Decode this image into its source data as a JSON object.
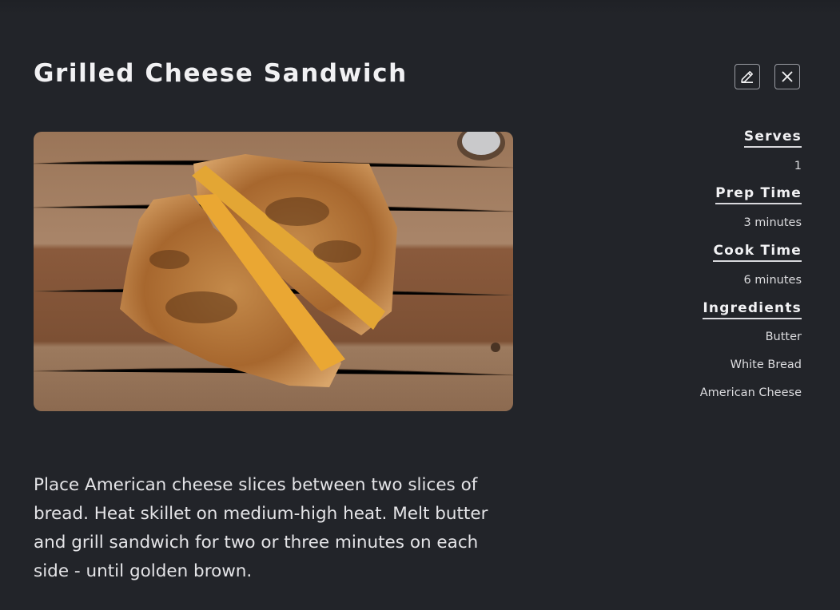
{
  "recipe": {
    "title": "Grilled Cheese Sandwich",
    "directions": "Place American cheese slices between two slices of bread. Heat skillet on medium-high heat. Melt butter and grill sandwich for two or three minutes on each side - until golden brown."
  },
  "toolbar": {
    "edit_icon": "pencil-icon",
    "close_icon": "close-icon"
  },
  "meta": {
    "serves_label": "Serves",
    "serves_value": "1",
    "prep_label": "Prep Time",
    "prep_value": "3 minutes",
    "cook_label": "Cook Time",
    "cook_value": "6 minutes",
    "ingredients_label": "Ingredients",
    "ingredients": [
      "Butter",
      "White Bread",
      "American Cheese"
    ]
  },
  "colors": {
    "background": "#222429",
    "text": "#e7e7e9",
    "border": "#9a9ca3"
  }
}
